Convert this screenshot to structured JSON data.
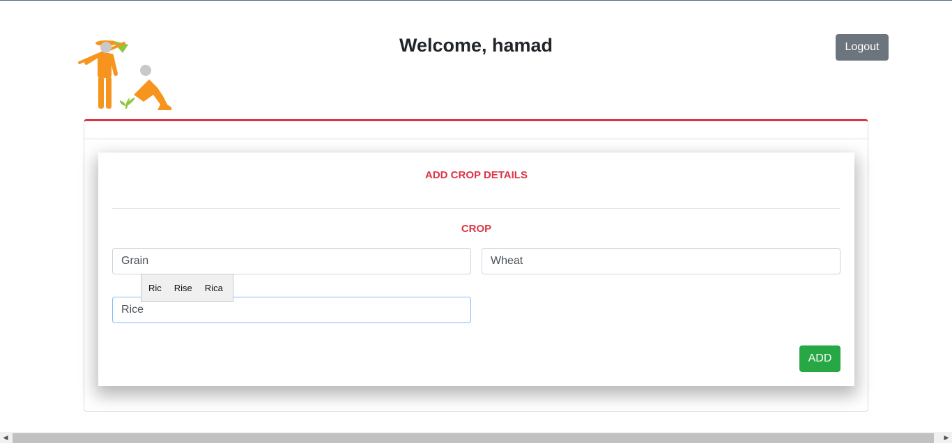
{
  "header": {
    "welcome_text": "Welcome, hamad",
    "logout_label": "Logout"
  },
  "form": {
    "title": "ADD CROP DETAILS",
    "section_title": "CROP",
    "fields": {
      "category_value": "Grain",
      "name_value": "Wheat",
      "variety_value": "Rice"
    },
    "suggestions": [
      "Ric",
      "Rise",
      "Rica"
    ],
    "add_label": "ADD"
  },
  "colors": {
    "accent_red": "#dc3545",
    "add_green": "#28a745",
    "logout_gray": "#6c757d",
    "logo_orange": "#f7941d",
    "logo_green": "#8dc63f"
  },
  "icons": {
    "logo": "farmers-logo",
    "scroll_left": "scroll-left-arrow-icon",
    "scroll_right": "scroll-right-arrow-icon"
  }
}
